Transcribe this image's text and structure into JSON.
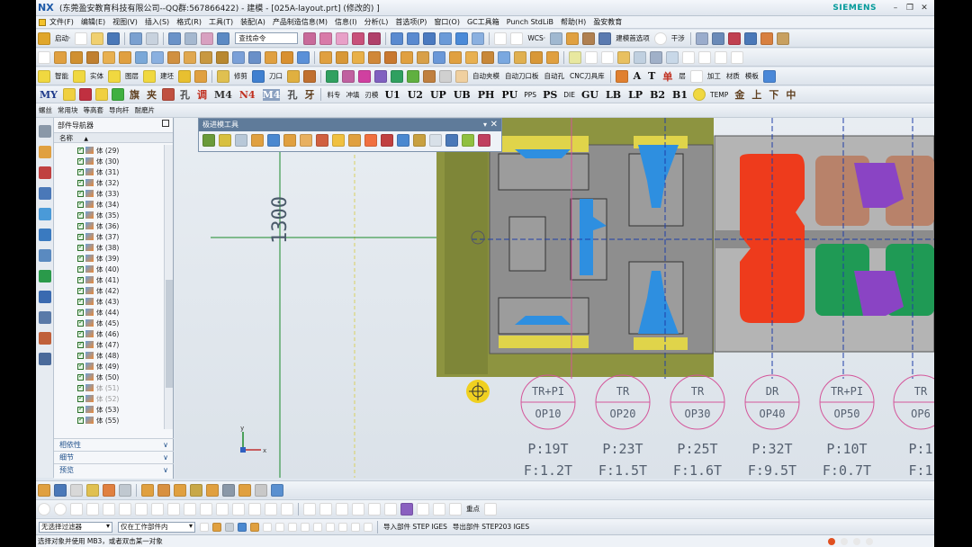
{
  "window": {
    "title": "(东莞盈安教育科技有限公司--QQ群:567866422) - 建模 - [025A-layout.prt] (修改的) ]",
    "logo": "NX",
    "brand": "SIEMENS"
  },
  "menu": [
    "文件(F)",
    "编辑(E)",
    "视图(V)",
    "插入(S)",
    "格式(R)",
    "工具(T)",
    "装配(A)",
    "产品制造信息(M)",
    "信息(I)",
    "分析(L)",
    "首选项(P)",
    "窗口(O)",
    "GC工具箱",
    "Punch StdLiB",
    "帮助(H)",
    "盈安教育"
  ],
  "toolbar1": {
    "start_label": "启动·",
    "search_placeholder": "查找命令",
    "wcs_label": "WCS·",
    "selection_label": "建模首选项",
    "interfere_label": "干涉"
  },
  "toolbar3": {
    "labels": [
      "智能",
      "实体",
      "图层",
      "建坯",
      "",
      "",
      "修剪",
      "刀口",
      "",
      "",
      "",
      "",
      "",
      "自动夹模",
      "自动刀口板",
      "自动孔",
      "CNC刀具库"
    ],
    "text_icons": [
      "A",
      "T",
      "单",
      "层",
      "加工",
      "材质",
      "模板"
    ]
  },
  "toolbar4": {
    "big_labels": [
      "MY",
      "旗",
      "夹",
      "孔",
      "调",
      "M4",
      "N4",
      "M4",
      "孔",
      "牙",
      "料专",
      "冲填",
      "刃模",
      "U1",
      "U2",
      "UP",
      "UB",
      "PH",
      "PU",
      "PPS",
      "PS",
      "DIE",
      "GU",
      "LB",
      "LP",
      "B2",
      "B1",
      "TEMP",
      "金",
      "上",
      "下",
      "中"
    ]
  },
  "toolbar5": {
    "labels": [
      "螺丝",
      "常用块",
      "等高套",
      "导向杆",
      "耐磨片"
    ]
  },
  "navigator": {
    "title": "部件导航器",
    "column": "名称",
    "rows": [
      {
        "label": "体 (29)",
        "dim": false
      },
      {
        "label": "体 (30)",
        "dim": false
      },
      {
        "label": "体 (31)",
        "dim": false
      },
      {
        "label": "体 (32)",
        "dim": false
      },
      {
        "label": "体 (33)",
        "dim": false
      },
      {
        "label": "体 (34)",
        "dim": false
      },
      {
        "label": "体 (35)",
        "dim": false
      },
      {
        "label": "体 (36)",
        "dim": false
      },
      {
        "label": "体 (37)",
        "dim": false
      },
      {
        "label": "体 (38)",
        "dim": false
      },
      {
        "label": "体 (39)",
        "dim": false
      },
      {
        "label": "体 (40)",
        "dim": false
      },
      {
        "label": "体 (41)",
        "dim": false
      },
      {
        "label": "体 (42)",
        "dim": false
      },
      {
        "label": "体 (43)",
        "dim": false
      },
      {
        "label": "体 (44)",
        "dim": false
      },
      {
        "label": "体 (45)",
        "dim": false
      },
      {
        "label": "体 (46)",
        "dim": false
      },
      {
        "label": "体 (47)",
        "dim": false
      },
      {
        "label": "体 (48)",
        "dim": false
      },
      {
        "label": "体 (49)",
        "dim": false
      },
      {
        "label": "体 (50)",
        "dim": false
      },
      {
        "label": "体 (51)",
        "dim": true
      },
      {
        "label": "体 (52)",
        "dim": true
      },
      {
        "label": "体 (53)",
        "dim": false
      },
      {
        "label": "体 (55)",
        "dim": false
      }
    ],
    "sections": [
      "相依性",
      "细节",
      "预览"
    ]
  },
  "floating_toolbar": {
    "title": "极进模工具"
  },
  "viewport": {
    "dimension": "1300",
    "stations": [
      {
        "process": "TR+PI",
        "op": "OP10",
        "pressure": "P:19T",
        "force": "F:1.2T"
      },
      {
        "process": "TR",
        "op": "OP20",
        "pressure": "P:23T",
        "force": "F:1.5T"
      },
      {
        "process": "TR",
        "op": "OP30",
        "pressure": "P:25T",
        "force": "F:1.6T"
      },
      {
        "process": "DR",
        "op": "OP40",
        "pressure": "P:32T",
        "force": "F:9.5T"
      },
      {
        "process": "TR+PI",
        "op": "OP50",
        "pressure": "P:10T",
        "force": "F:0.7T"
      },
      {
        "process": "TR",
        "op": "OP6",
        "pressure": "P:1",
        "force": "F:1"
      }
    ]
  },
  "bottom_toolbar2": {
    "labels": [
      "重点"
    ]
  },
  "filter_bar": {
    "filter_value": "无选择过滤器",
    "scope_value": "仅在工作部件内",
    "import_label": "导入部件 STEP IGES",
    "export_label": "导出部件 STEP203 IGES"
  },
  "status": {
    "text": "选择对象并使用 MB3，或者双击某一对象"
  },
  "colors": {
    "accent": "#1e5aa8",
    "siemens": "#009999",
    "plate_olive": "#8d9440",
    "station_circle": "#d4559a",
    "part_red": "#ee3b1c",
    "part_green": "#1f9a55",
    "part_purple": "#8a44c4",
    "part_blue": "#2e8fe0",
    "part_yellow": "#e6d84a"
  }
}
